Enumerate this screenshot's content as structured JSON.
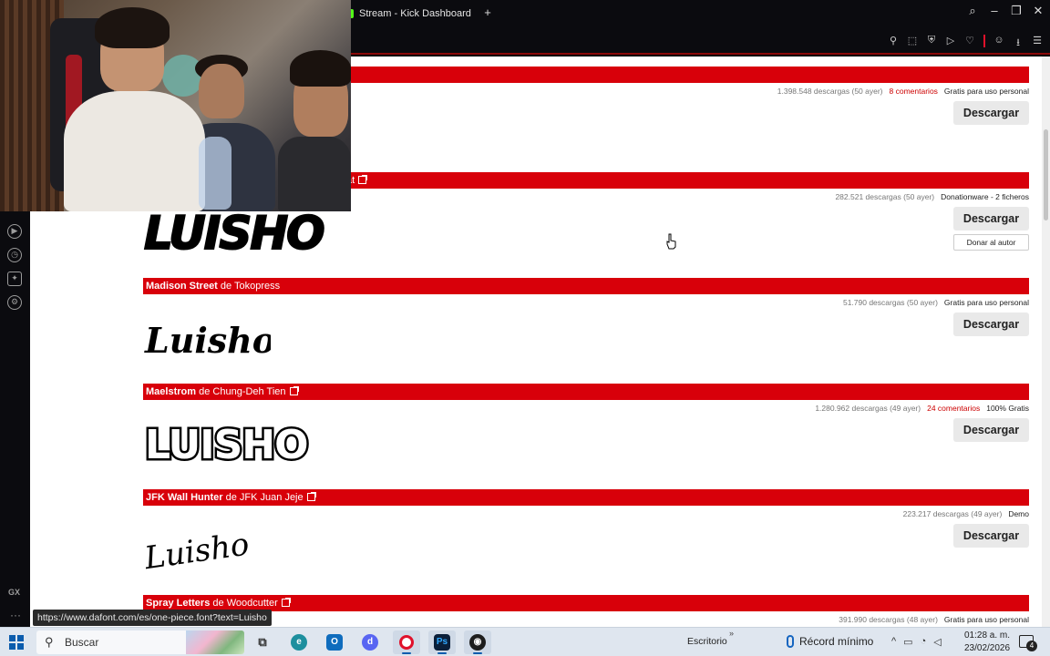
{
  "browser": {
    "tab_title": "Stream - Kick Dashboard",
    "new_tab": "+",
    "window_controls": [
      "search-icon",
      "minimize-icon",
      "restore-icon",
      "close-icon"
    ],
    "toolbar_icons": [
      "pin-icon",
      "snapshot-icon",
      "shield-icon",
      "play-icon",
      "heart-icon",
      "account-icon",
      "download-icon",
      "menu-icon"
    ],
    "accent_color": "#e0112b"
  },
  "sidebar": {
    "icons": [
      "player-icon",
      "history-icon",
      "extensions-icon",
      "settings-icon"
    ],
    "gx_label": "GX",
    "more_label": "···"
  },
  "fonts": [
    {
      "name": "",
      "author_prefix": "",
      "author": "",
      "downloads": "1.398.548 descargas (50 ayer)",
      "comments": "8 comentarios",
      "license": "Gratis para uso personal",
      "download_label": "Descargar",
      "donate_label": "",
      "preview_text": ""
    },
    {
      "name": "",
      "author_prefix": "",
      "author": "at",
      "downloads": "282.521 descargas (50 ayer)",
      "comments": "",
      "license": "Donationware - 2 ficheros",
      "download_label": "Descargar",
      "donate_label": "Donar al autor",
      "preview_text": "LUISHO"
    },
    {
      "name": "Madison Street",
      "author_prefix": "de",
      "author": "Tokopress",
      "downloads": "51.790 descargas (50 ayer)",
      "comments": "",
      "license": "Gratis para uso personal",
      "download_label": "Descargar",
      "donate_label": "",
      "preview_text": "Luisho"
    },
    {
      "name": "Maelstrom",
      "author_prefix": "de",
      "author": "Chung-Deh Tien",
      "downloads": "1.280.962 descargas (49 ayer)",
      "comments": "24 comentarios",
      "license": "100% Gratis",
      "download_label": "Descargar",
      "donate_label": "",
      "preview_text": "LUISHO"
    },
    {
      "name": "JFK Wall Hunter",
      "author_prefix": "de",
      "author": "JFK Juan Jeje",
      "downloads": "223.217 descargas (49 ayer)",
      "comments": "",
      "license": "Demo",
      "download_label": "Descargar",
      "donate_label": "",
      "preview_text": "Luisho"
    },
    {
      "name": "Spray Letters",
      "author_prefix": "de",
      "author": "Woodcutter",
      "downloads": "391.990 descargas (48 ayer)",
      "comments": "",
      "license": "Gratis para uso personal",
      "download_label": "",
      "donate_label": "",
      "preview_text": ""
    }
  ],
  "status_url": "https://www.dafont.com/es/one-piece.font?text=Luisho",
  "taskbar": {
    "search_placeholder": "Buscar",
    "desktop_label": "Escritorio",
    "overflow": "»",
    "weather_text": "Récord mínimo",
    "time": "01:28 a. m.",
    "date": "23/02/2026",
    "notification_count": "4",
    "apps": [
      "task-view-icon",
      "edge-icon",
      "outlook-icon",
      "discord-icon",
      "opera-gx-icon",
      "photoshop-icon",
      "obs-icon"
    ]
  },
  "colors": {
    "bar_red": "#d8000a",
    "comment_red": "#cc0000",
    "button_gray": "#e9e9e9"
  }
}
